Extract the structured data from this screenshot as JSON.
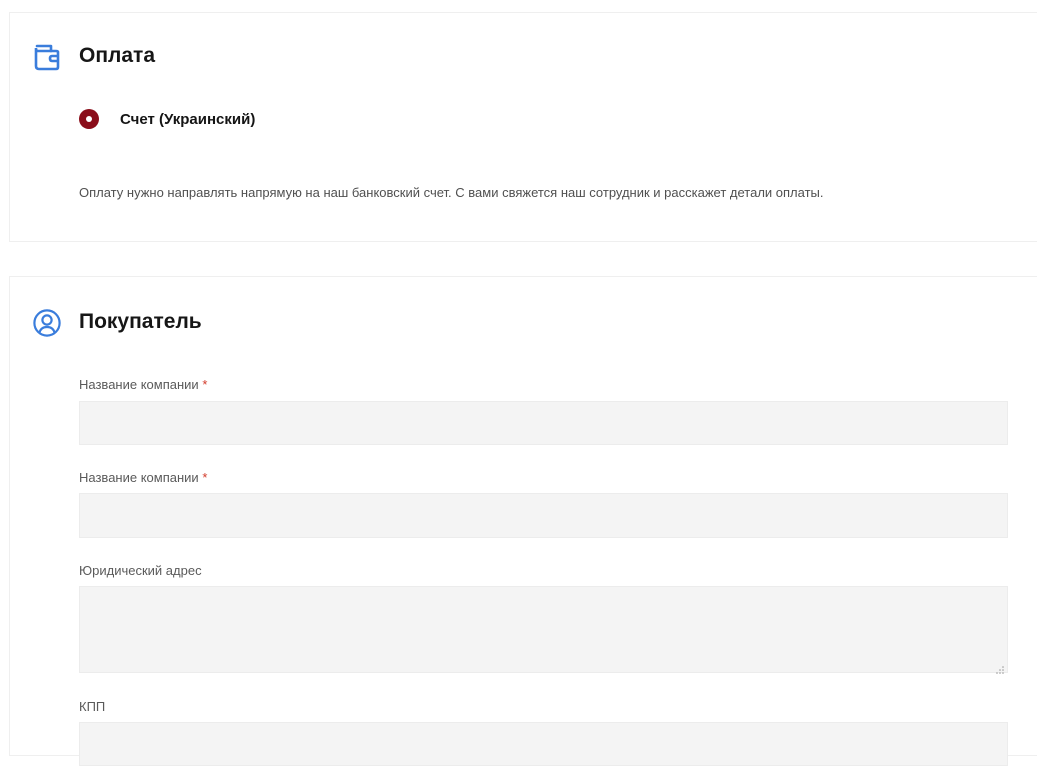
{
  "payment": {
    "title": "Оплата",
    "icon": "wallet-icon",
    "option_label": "Счет (Украинский)",
    "option_selected": true,
    "description": "Оплату нужно направлять напрямую на наш банковский счет. С вами свяжется наш сотрудник и расскажет детали оплаты."
  },
  "buyer": {
    "title": "Покупатель",
    "icon": "user-circle-icon",
    "fields": [
      {
        "label": "Название компании",
        "required_mark": "*",
        "value": ""
      },
      {
        "label": "Название компании",
        "required_mark": "*",
        "value": ""
      },
      {
        "label": "Юридический адрес",
        "value": ""
      },
      {
        "label": "КПП",
        "value": ""
      }
    ]
  },
  "colors": {
    "accent_blue": "#3a7ddc",
    "radio_selected": "#8a0d1a",
    "required": "#d23a2a",
    "input_bg": "#f4f4f4"
  }
}
